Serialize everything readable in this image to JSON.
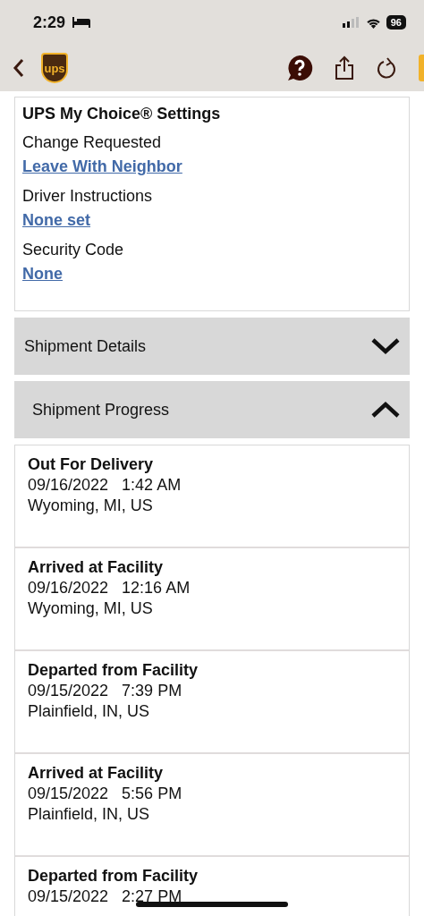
{
  "status_bar": {
    "time": "2:29",
    "battery": "96"
  },
  "nav": {
    "logo": "ups"
  },
  "settings": {
    "title": "UPS My Choice® Settings",
    "items": [
      {
        "label": "Change Requested",
        "value": "Leave With Neighbor"
      },
      {
        "label": "Driver Instructions",
        "value": "None set"
      },
      {
        "label": "Security Code",
        "value": "None"
      }
    ]
  },
  "sections": [
    {
      "title": "Shipment Details",
      "expanded": false
    },
    {
      "title": "Shipment Progress",
      "expanded": true
    }
  ],
  "progress": [
    {
      "status": "Out For Delivery",
      "date": "09/16/2022",
      "time": "1:42 AM",
      "location": "Wyoming, MI, US"
    },
    {
      "status": "Arrived at Facility",
      "date": "09/16/2022",
      "time": "12:16 AM",
      "location": "Wyoming, MI, US"
    },
    {
      "status": "Departed from Facility",
      "date": "09/15/2022",
      "time": "7:39 PM",
      "location": "Plainfield, IN, US"
    },
    {
      "status": "Arrived at Facility",
      "date": "09/15/2022",
      "time": "5:56 PM",
      "location": "Plainfield, IN, US"
    },
    {
      "status": "Departed from Facility",
      "date": "09/15/2022",
      "time": "2:27 PM"
    }
  ]
}
